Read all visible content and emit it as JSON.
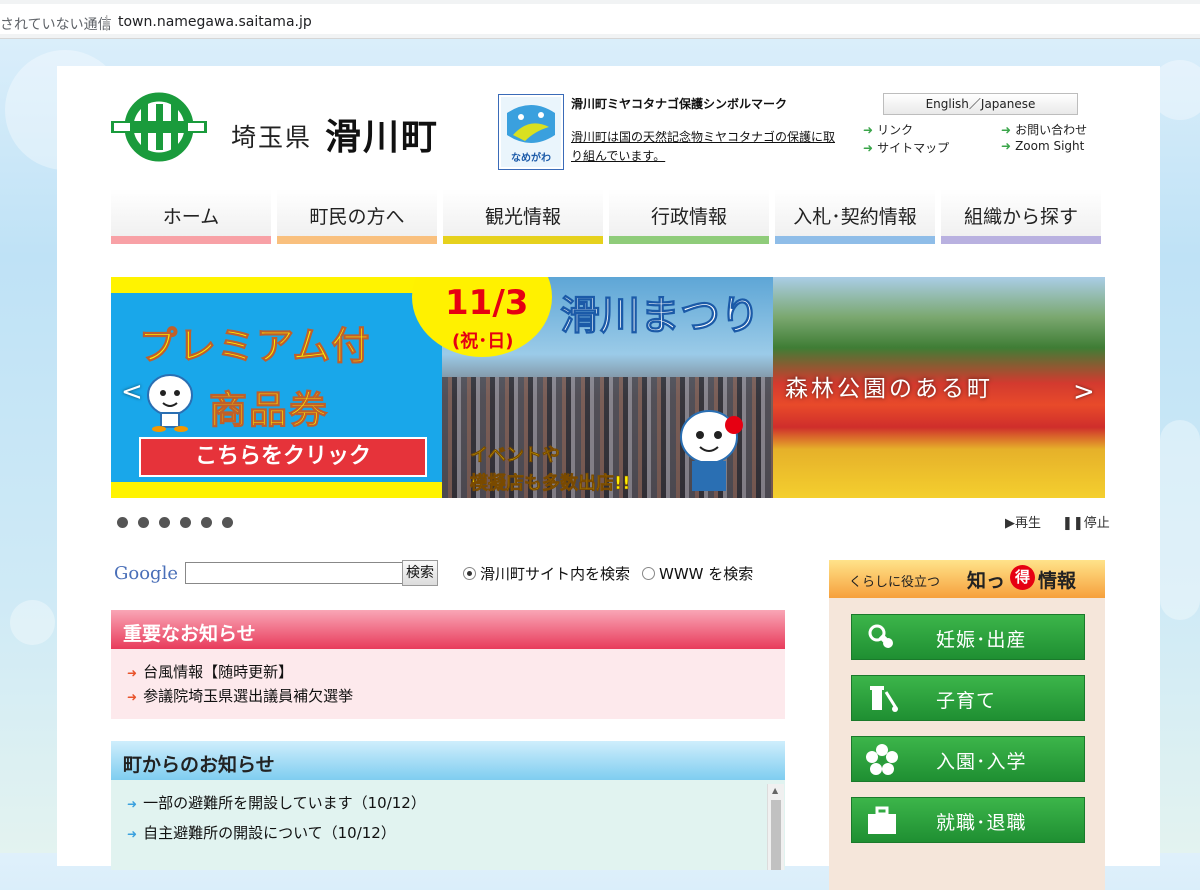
{
  "browser": {
    "security_text": "されていない通信",
    "url": "town.namegawa.saitama.jp"
  },
  "header": {
    "prefecture": "埼玉県",
    "town_name": "滑川町",
    "symbol_logo_text": "なめがわ",
    "symbol_title": "滑川町ミヤコタナゴ保護シンボルマーク",
    "symbol_link": "滑川町は国の天然記念物ミヤコタナゴの保護に取り組んでいます。",
    "lang_button": "English／Japanese",
    "links": [
      {
        "label": "リンク"
      },
      {
        "label": "お問い合わせ"
      },
      {
        "label": "サイトマップ"
      },
      {
        "label": "Zoom Sight"
      }
    ]
  },
  "nav": {
    "items": [
      {
        "label": "ホーム",
        "color": "#f8a1a6"
      },
      {
        "label": "町民の方へ",
        "color": "#f9c07e"
      },
      {
        "label": "観光情報",
        "color": "#e6d11d"
      },
      {
        "label": "行政情報",
        "color": "#8fcc7a"
      },
      {
        "label": "入札･契約情報",
        "color": "#8fbde8"
      },
      {
        "label": "組織から探す",
        "color": "#b9b1e0"
      }
    ]
  },
  "slider": {
    "slide1": {
      "line1": "プレミアム付",
      "line2": "商品券",
      "cta": "こちらをクリック"
    },
    "slide2": {
      "date": "11/3",
      "dow": "(祝･日)",
      "title": "滑川まつり",
      "sub1": "イベントや",
      "sub2": "模擬店も多数出店!!"
    },
    "slide3": {
      "caption": "森林公園のある町"
    },
    "prev": "<",
    "next": ">",
    "play": "▶再生",
    "stop": "❚❚停止"
  },
  "search": {
    "logo": "Google",
    "button": "検索",
    "option_site": "滑川町サイト内を検索",
    "option_www": "WWW を検索"
  },
  "important_notices": {
    "title": "重要なお知らせ",
    "items": [
      "台風情報【随時更新】",
      "参議院埼玉県選出議員補欠選挙"
    ]
  },
  "town_notices": {
    "title": "町からのお知らせ",
    "items": [
      "一部の避難所を開設しています（10/12）",
      "自主避難所の開設について（10/12）"
    ]
  },
  "kurashi": {
    "pre": "くらしに役立つ",
    "shiru": "知っ",
    "toku": "得",
    "joho": "情報",
    "buttons": [
      {
        "label": "妊娠･出産",
        "icon": "pacifier-icon"
      },
      {
        "label": "子育て",
        "icon": "baby-bottle-icon"
      },
      {
        "label": "入園･入学",
        "icon": "cherry-blossom-icon"
      },
      {
        "label": "就職･退職",
        "icon": "briefcase-icon"
      }
    ]
  }
}
